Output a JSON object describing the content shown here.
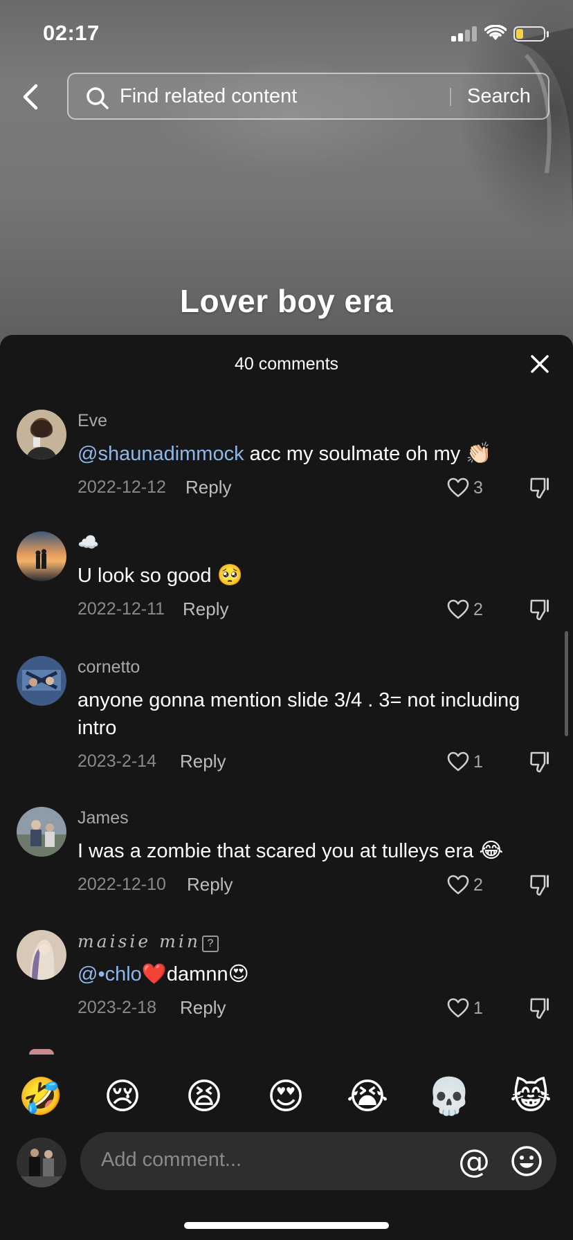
{
  "status_bar": {
    "time": "02:17"
  },
  "search": {
    "placeholder": "Find related content",
    "button_label": "Search"
  },
  "video": {
    "caption": "Lover boy era"
  },
  "comments_panel": {
    "title": "40 comments",
    "comments": [
      {
        "username": "Eve",
        "mention": "@shaunadimmock",
        "text": " acc my soulmate oh my ",
        "emoji": "👏🏻",
        "date": "2022-12-12",
        "reply_label": "Reply",
        "likes": "3"
      },
      {
        "username": "☁️",
        "mention": "",
        "text": "U look so good ",
        "emoji": "🥺",
        "date": "2022-12-11",
        "reply_label": "Reply",
        "likes": "2"
      },
      {
        "username": "cornetto",
        "mention": "",
        "text": "anyone gonna mention slide 3/4 . 3= not including intro",
        "emoji": "",
        "date": "2023-2-14",
        "reply_label": "Reply",
        "likes": "1"
      },
      {
        "username": "James",
        "mention": "",
        "text": "I was a zombie that scared you at tulleys era ",
        "emoji": "😂",
        "date": "2022-12-10",
        "reply_label": "Reply",
        "likes": "2"
      },
      {
        "username": "maisie min",
        "username_suffix": "?",
        "mention": "@•chlo",
        "text": "❤️damnn😍",
        "emoji": "",
        "date": "2023-2-18",
        "reply_label": "Reply",
        "likes": "1"
      }
    ]
  },
  "quick_emojis": [
    "🤣",
    "😢",
    "😫",
    "😍",
    "😭",
    "💀",
    "😹"
  ],
  "composer": {
    "placeholder": "Add comment...",
    "mention_symbol": "@"
  },
  "icons": {
    "back": "chevron-left-icon",
    "search": "search-icon",
    "close": "close-icon",
    "like": "heart-outline-icon",
    "dislike": "thumbs-down-icon",
    "emoji_picker": "smiley-icon"
  },
  "colors": {
    "sheet_background": "#161616",
    "mention": "#8fb7ea",
    "muted_text": "#8a8a8a",
    "input_background": "#2e2e2e",
    "battery": "#f5d24a"
  }
}
